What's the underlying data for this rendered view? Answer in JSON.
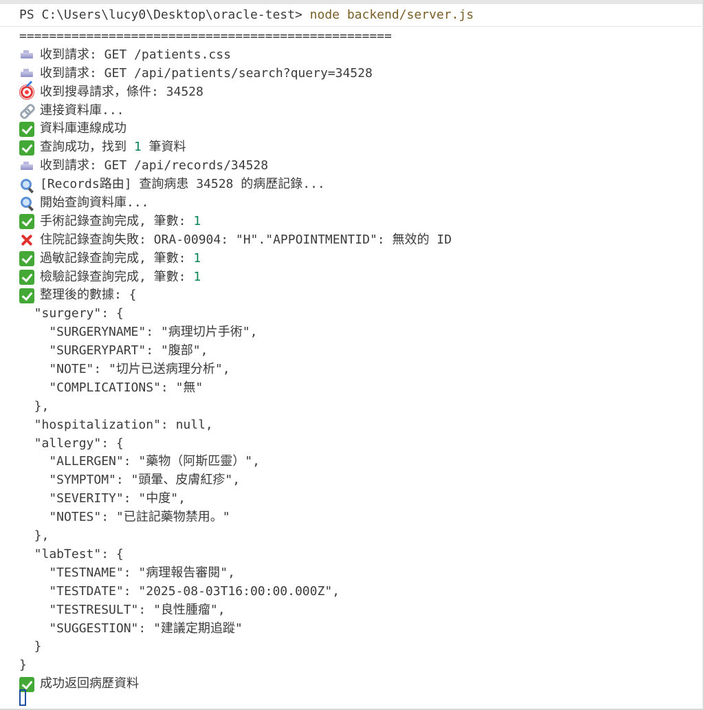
{
  "terminal": {
    "prompt": "PS C:\\Users\\lucy0\\Desktop\\oracle-test> ",
    "command": "node backend/server.js",
    "lines": [
      {
        "icon": "",
        "text": "=================================================="
      },
      {
        "icon": "inbox-icon",
        "text": "收到請求: GET /patients.css"
      },
      {
        "icon": "inbox-icon",
        "text": "收到請求: GET /api/patients/search?query=34528"
      },
      {
        "icon": "target-icon",
        "text": "收到搜尋請求，條件: 34528"
      },
      {
        "icon": "link-icon",
        "text": "連接資料庫..."
      },
      {
        "icon": "check-icon",
        "text": "資料庫連線成功"
      },
      {
        "icon": "check-icon",
        "text": "查詢成功，找到 ",
        "num": "1",
        "tail": " 筆資料"
      },
      {
        "icon": "inbox-icon",
        "text": "收到請求: GET /api/records/34528"
      },
      {
        "icon": "magnifier-icon",
        "text": "[Records路由] 查詢病患 34528 的病歷記錄..."
      },
      {
        "icon": "magnifier-icon",
        "text": "開始查詢資料庫..."
      },
      {
        "icon": "check-icon",
        "text": "手術記錄查詢完成, 筆數: ",
        "num": "1"
      },
      {
        "icon": "cross-icon",
        "text": "住院記錄查詢失敗: ORA-00904: \"H\".\"APPOINTMENTID\": 無效的 ID"
      },
      {
        "icon": "check-icon",
        "text": "過敏記錄查詢完成, 筆數: ",
        "num": "1"
      },
      {
        "icon": "check-icon",
        "text": "檢驗記錄查詢完成, 筆數: ",
        "num": "1"
      },
      {
        "icon": "check-icon",
        "text": "整理後的數據: {"
      },
      {
        "icon": "",
        "text": "  \"surgery\": {"
      },
      {
        "icon": "",
        "text": "    \"SURGERYNAME\": \"病理切片手術\","
      },
      {
        "icon": "",
        "text": "    \"SURGERYPART\": \"腹部\","
      },
      {
        "icon": "",
        "text": "    \"NOTE\": \"切片已送病理分析\","
      },
      {
        "icon": "",
        "text": "    \"COMPLICATIONS\": \"無\""
      },
      {
        "icon": "",
        "text": "  },"
      },
      {
        "icon": "",
        "text": "  \"hospitalization\": null,"
      },
      {
        "icon": "",
        "text": "  \"allergy\": {"
      },
      {
        "icon": "",
        "text": "    \"ALLERGEN\": \"藥物（阿斯匹靈）\","
      },
      {
        "icon": "",
        "text": "    \"SYMPTOM\": \"頭暈、皮膚紅疹\","
      },
      {
        "icon": "",
        "text": "    \"SEVERITY\": \"中度\","
      },
      {
        "icon": "",
        "text": "    \"NOTES\": \"已註記藥物禁用。\""
      },
      {
        "icon": "",
        "text": "  },"
      },
      {
        "icon": "",
        "text": "  \"labTest\": {"
      },
      {
        "icon": "",
        "text": "    \"TESTNAME\": \"病理報告審閱\","
      },
      {
        "icon": "",
        "text": "    \"TESTDATE\": \"2025-08-03T16:00:00.000Z\","
      },
      {
        "icon": "",
        "text": "    \"TESTRESULT\": \"良性腫瘤\","
      },
      {
        "icon": "",
        "text": "    \"SUGGESTION\": \"建議定期追蹤\""
      },
      {
        "icon": "",
        "text": "  }"
      },
      {
        "icon": "",
        "text": "}"
      },
      {
        "icon": "check-icon",
        "text": "成功返回病歷資料"
      }
    ]
  },
  "colors": {
    "text": "#3b3b3b",
    "number": "#098658",
    "command": "#795e26",
    "check": "#44a836",
    "cross": "#e0312f",
    "cursor": "#1e4fa3"
  }
}
